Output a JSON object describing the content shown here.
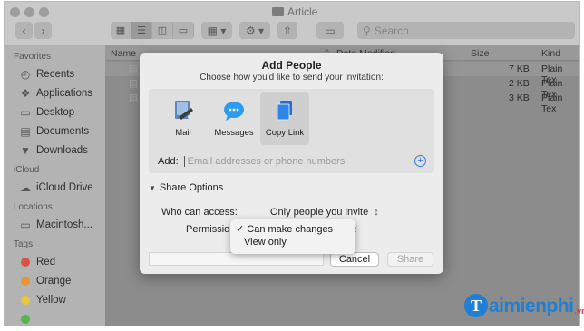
{
  "window": {
    "title": "Article"
  },
  "toolbar": {
    "back_icon": "chevron-left",
    "forward_icon": "chevron-right",
    "view_icons": [
      "grid",
      "list",
      "columns",
      "gallery"
    ],
    "group_icon": "group-grid",
    "action_icon": "gear",
    "share_icon": "share",
    "tag_icon": "tag",
    "search_placeholder": "Search"
  },
  "sidebar": {
    "favorites_title": "Favorites",
    "favorites": [
      {
        "label": "Recents",
        "icon": "clock"
      },
      {
        "label": "Applications",
        "icon": "apps"
      },
      {
        "label": "Desktop",
        "icon": "desktop"
      },
      {
        "label": "Documents",
        "icon": "document"
      },
      {
        "label": "Downloads",
        "icon": "download"
      }
    ],
    "icloud_title": "iCloud",
    "icloud": [
      {
        "label": "iCloud Drive",
        "icon": "cloud"
      }
    ],
    "locations_title": "Locations",
    "locations": [
      {
        "label": "Macintosh...",
        "icon": "disk"
      }
    ],
    "tags_title": "Tags",
    "tags": [
      {
        "label": "Red",
        "color": "#d9524a"
      },
      {
        "label": "Orange",
        "color": "#e8953a"
      },
      {
        "label": "Yellow",
        "color": "#e8c53a"
      },
      {
        "label": "",
        "color": "#58b34f"
      }
    ]
  },
  "file_list": {
    "columns": {
      "name": "Name",
      "date": "Date Modified",
      "size": "Size",
      "kind": "Kind"
    },
    "rows": [
      {
        "size": "7 KB",
        "kind": "Plain Tex"
      },
      {
        "size": "2 KB",
        "kind": "Plain Tex"
      },
      {
        "size": "3 KB",
        "kind": "Plain Tex"
      }
    ]
  },
  "dialog": {
    "title": "Add People",
    "subtitle": "Choose how you'd like to send your invitation:",
    "methods": [
      {
        "label": "Mail",
        "icon": "mail"
      },
      {
        "label": "Messages",
        "icon": "messages"
      },
      {
        "label": "Copy Link",
        "icon": "copy-link"
      }
    ],
    "add_label": "Add:",
    "add_placeholder": "Email addresses or phone numbers",
    "share_options_label": "Share Options",
    "who_label": "Who can access:",
    "who_value": "Only people you invite",
    "permission_label": "Permission",
    "permission_options": [
      {
        "label": "Can make changes",
        "checked": true
      },
      {
        "label": "View only",
        "checked": false
      }
    ],
    "cancel_label": "Cancel",
    "share_label": "Share"
  },
  "watermark": {
    "brand": "aimienphi",
    "suffix": ".vn"
  },
  "colors": {
    "accent": "#2f78e3",
    "watermark_blue": "#1e7fd4",
    "watermark_red": "#e03a2b"
  }
}
